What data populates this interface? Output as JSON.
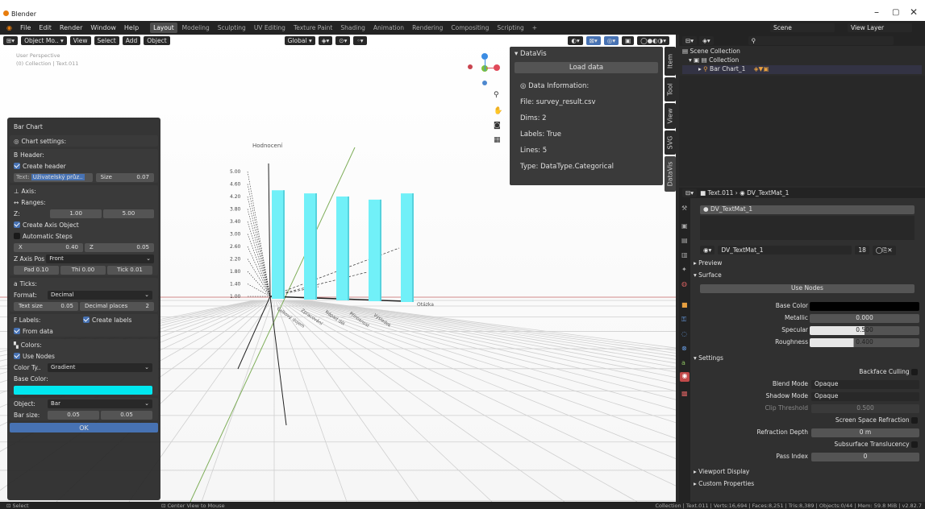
{
  "app": {
    "title": "Blender",
    "window_controls": {
      "minimize": "–",
      "maximize": "▢",
      "close": "✕"
    }
  },
  "menu": [
    "File",
    "Edit",
    "Render",
    "Window",
    "Help"
  ],
  "workspaces": [
    "Layout",
    "Modeling",
    "Sculpting",
    "UV Editing",
    "Texture Paint",
    "Shading",
    "Animation",
    "Rendering",
    "Compositing",
    "Scripting",
    "+"
  ],
  "active_workspace": "Layout",
  "scene": {
    "name": "Scene",
    "view_layer": "View Layer"
  },
  "viewport": {
    "mode": "Object Mo..",
    "menus": [
      "View",
      "Select",
      "Add",
      "Object"
    ],
    "orientation": "Global",
    "overlay_title": "User Perspective",
    "overlay_sub": "(0) Collection | Text.011",
    "axis_labels": {
      "y": "Hodnocení",
      "x": "Otázka"
    },
    "ticks": [
      "5.00",
      "4.60",
      "4.20",
      "3.80",
      "3.40",
      "3.00",
      "2.60",
      "2.20",
      "1.80",
      "1.40",
      "1.00"
    ],
    "categories": [
      "Celkový dojem",
      "Zpracování",
      "Nápad děl",
      "Přínosnost",
      "Výsledek"
    ],
    "bar_values": [
      4.4,
      4.3,
      4.2,
      4.1,
      4.3
    ],
    "bar_color": "#71f0f8"
  },
  "bar_chart": {
    "title": "Bar Chart",
    "chart_settings": "Chart settings:",
    "header_label": "Header:",
    "create_header": "Create header",
    "text_label": "Text:",
    "text_value": "Uživatelský průz..",
    "size_label": "Size",
    "size_value": "0.07",
    "axis_label": "Axis:",
    "ranges_label": "Ranges:",
    "z_label": "Z:",
    "z_min": "1.00",
    "z_max": "5.00",
    "create_axis": "Create Axis Object",
    "auto_steps": "Automatic Steps",
    "x_label": "X",
    "x_value": "0.40",
    "z2_label": "Z",
    "z2_value": "0.05",
    "zpos_label": "Z Axis Pos",
    "zpos_value": "Front",
    "pad": "Pad  0.10",
    "thi": "Thi  0.00",
    "tick": "Tick  0.01",
    "ticks_label": "Ticks:",
    "format_label": "Format:",
    "format_value": "Decimal",
    "text_size_label": "Text size",
    "text_size_value": "0.05",
    "dec_label": "Decimal places",
    "dec_value": "2",
    "labels_label": "Labels:",
    "create_labels": "Create labels",
    "from_data": "From data",
    "colors_label": "Colors:",
    "use_nodes": "Use Nodes",
    "color_type_label": "Color Ty..",
    "color_type_value": "Gradient",
    "base_color_label": "Base Color:",
    "base_color": "#00e8f0",
    "object_label": "Object:",
    "object_value": "Bar",
    "bar_size_label": "Bar size:",
    "bar_size_a": "0.05",
    "bar_size_b": "0.05",
    "ok": "OK"
  },
  "datavis": {
    "title": "DataVis",
    "load": "Load data",
    "info": "Data Information:",
    "file": "File: survey_result.csv",
    "dims": "Dims: 2",
    "labels": "Labels: True",
    "lines": "Lines: 5",
    "type": "Type: DataType.Categorical"
  },
  "side_tabs": [
    "Item",
    "Tool",
    "View",
    "SVG",
    "DataVis"
  ],
  "outliner": {
    "scene_collection": "Scene Collection",
    "collection": "Collection",
    "item": "Bar Chart_1"
  },
  "properties": {
    "breadcrumb_obj": "Text.011",
    "breadcrumb_mat": "DV_TextMat_1",
    "slot": "DV_TextMat_1",
    "material": "DV_TextMat_1",
    "users": "18",
    "preview": "Preview",
    "surface": "Surface",
    "use_nodes": "Use Nodes",
    "base_color_label": "Base Color",
    "base_color": "#000000",
    "metallic_label": "Metallic",
    "metallic": "0.000",
    "specular_label": "Specular",
    "specular": "0.500",
    "roughness_label": "Roughness",
    "roughness": "0.400",
    "settings": "Settings",
    "backface": "Backface Culling",
    "blend_label": "Blend Mode",
    "blend": "Opaque",
    "shadow_label": "Shadow Mode",
    "shadow": "Opaque",
    "clip_label": "Clip Threshold",
    "clip": "0.500",
    "ssr": "Screen Space Refraction",
    "refr_label": "Refraction Depth",
    "refr": "0 m",
    "sss": "Subsurface Translucency",
    "pass_label": "Pass Index",
    "pass": "0",
    "viewport_display": "Viewport Display",
    "custom_props": "Custom Properties"
  },
  "status": {
    "select": "Select",
    "center": "Center View to Mouse",
    "stats": "Collection | Text.011 | Verts:16,694 | Faces:8,251 | Tris:8,389 | Objects:0/44 | Mem: 59.8 MiB | v2.82.7"
  }
}
